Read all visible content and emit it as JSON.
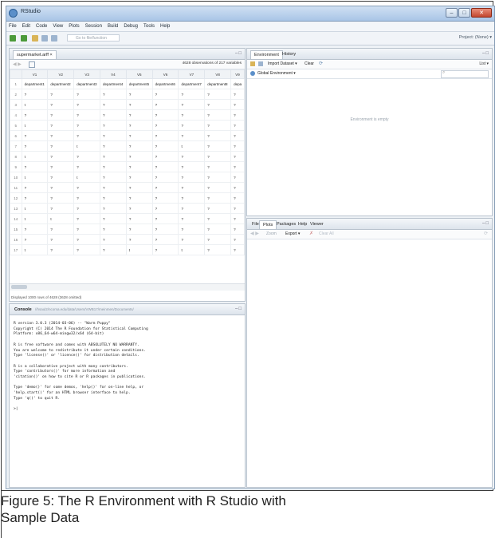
{
  "window": {
    "title": "RStudio"
  },
  "menu": [
    "File",
    "Edit",
    "Code",
    "View",
    "Plots",
    "Session",
    "Build",
    "Debug",
    "Tools",
    "Help"
  ],
  "toolbar": {
    "goto_placeholder": "Go to file/function",
    "project_label": "Project: (None) ▾"
  },
  "editor": {
    "tab_label": "supermarket.arff ×",
    "observations": "4628 observations of 217 variables",
    "columns": [
      "V1",
      "V2",
      "V3",
      "V4",
      "V5",
      "V6",
      "V7",
      "V8",
      "V9"
    ],
    "header_row": [
      "department1",
      "department2",
      "department3",
      "department4",
      "department5",
      "department6",
      "department7",
      "department8",
      "depa"
    ],
    "rows": [
      [
        "?",
        "?",
        "?",
        "?",
        "?",
        "?",
        "?",
        "?",
        "?"
      ],
      [
        "t",
        "?",
        "?",
        "?",
        "?",
        "?",
        "?",
        "?",
        "?"
      ],
      [
        "?",
        "?",
        "?",
        "?",
        "?",
        "?",
        "?",
        "?",
        "?"
      ],
      [
        "t",
        "?",
        "?",
        "?",
        "?",
        "?",
        "?",
        "?",
        "?"
      ],
      [
        "?",
        "?",
        "?",
        "?",
        "?",
        "?",
        "?",
        "?",
        "?"
      ],
      [
        "?",
        "?",
        "t",
        "?",
        "?",
        "?",
        "t",
        "?",
        "?"
      ],
      [
        "t",
        "?",
        "?",
        "?",
        "?",
        "?",
        "?",
        "?",
        "?"
      ],
      [
        "?",
        "?",
        "?",
        "?",
        "?",
        "?",
        "?",
        "?",
        "?"
      ],
      [
        "t",
        "?",
        "t",
        "?",
        "?",
        "?",
        "?",
        "?",
        "?"
      ],
      [
        "?",
        "?",
        "?",
        "?",
        "?",
        "?",
        "?",
        "?",
        "?"
      ],
      [
        "?",
        "?",
        "?",
        "?",
        "?",
        "?",
        "?",
        "?",
        "?"
      ],
      [
        "t",
        "?",
        "?",
        "?",
        "?",
        "?",
        "?",
        "?",
        "?"
      ],
      [
        "t",
        "t",
        "?",
        "?",
        "?",
        "?",
        "?",
        "?",
        "?"
      ],
      [
        "?",
        "?",
        "?",
        "?",
        "?",
        "?",
        "?",
        "?",
        "?"
      ],
      [
        "?",
        "?",
        "?",
        "?",
        "?",
        "?",
        "?",
        "?",
        "?"
      ],
      [
        "t",
        "?",
        "?",
        "?",
        "t",
        "?",
        "t",
        "?",
        "?"
      ]
    ],
    "status": "Displayed 1000 rows of 4628 (3628 omitted)"
  },
  "console": {
    "tab_label": "Console",
    "path": "//hsaul2/ncoma.edu/data/Users/VWB17/meinmen/Documents/",
    "text": "R version 3.0.3 (2014-03-06) -- \"Warm Puppy\"\nCopyright (C) 2014 The R Foundation for Statistical Computing\nPlatform: x86_64-w64-mingw32/x64 (64-bit)\n\nR is free software and comes with ABSOLUTELY NO WARRANTY.\nYou are welcome to redistribute it under certain conditions.\nType 'license()' or 'licence()' for distribution details.\n\nR is a collaborative project with many contributors.\nType 'contributors()' for more information and\n'citation()' on how to cite R or R packages in publications.\n\nType 'demo()' for some demos, 'help()' for on-line help, or\n'help.start()' for an HTML browser interface to help.\nType 'q()' to quit R.\n\n>|"
  },
  "environment": {
    "tabs": [
      "Environment",
      "History"
    ],
    "import_label": "Import Dataset ▾",
    "clear_label": "Clear",
    "list_label": "List ▾",
    "scope_label": "Global Environment ▾",
    "empty_text": "Environment is empty"
  },
  "files": {
    "tabs": [
      "Files",
      "Plots",
      "Packages",
      "Help",
      "Viewer"
    ],
    "zoom_label": "Zoom",
    "export_label": "Export ▾",
    "clear_all_label": "Clear All"
  },
  "caption": {
    "line1": "Figure 5: The R Environment with R Studio with",
    "line2": "Sample Data"
  }
}
